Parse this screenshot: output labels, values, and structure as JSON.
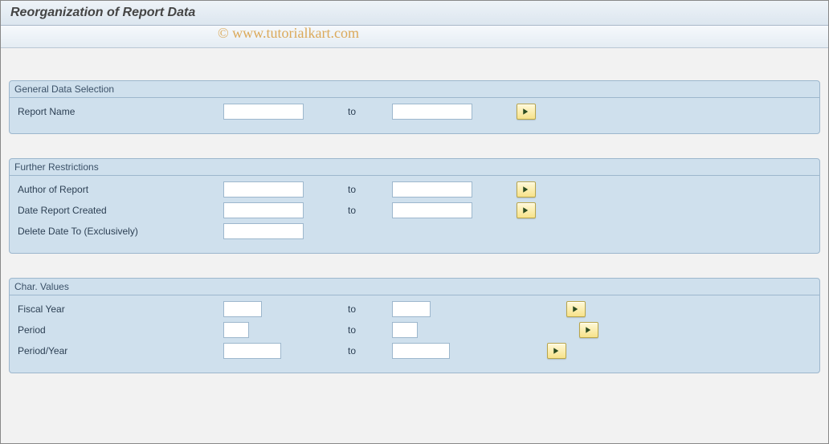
{
  "title": "Reorganization of Report Data",
  "watermark": "© www.tutorialkart.com",
  "groups": {
    "general": {
      "title": "General Data Selection",
      "rows": {
        "report_name": {
          "label": "Report Name",
          "from": "",
          "to_label": "to",
          "to": ""
        }
      }
    },
    "restrictions": {
      "title": "Further Restrictions",
      "rows": {
        "author": {
          "label": "Author of Report",
          "from": "",
          "to_label": "to",
          "to": ""
        },
        "date_created": {
          "label": "Date Report Created",
          "from": "",
          "to_label": "to",
          "to": ""
        },
        "delete_date": {
          "label": "Delete Date To (Exclusively)",
          "from": ""
        }
      }
    },
    "char_values": {
      "title": "Char. Values",
      "rows": {
        "fiscal_year": {
          "label": "Fiscal Year",
          "from": "",
          "to_label": "to",
          "to": ""
        },
        "period": {
          "label": "Period",
          "from": "",
          "to_label": "to",
          "to": ""
        },
        "period_year": {
          "label": "Period/Year",
          "from": "",
          "to_label": "to",
          "to": ""
        }
      }
    }
  }
}
